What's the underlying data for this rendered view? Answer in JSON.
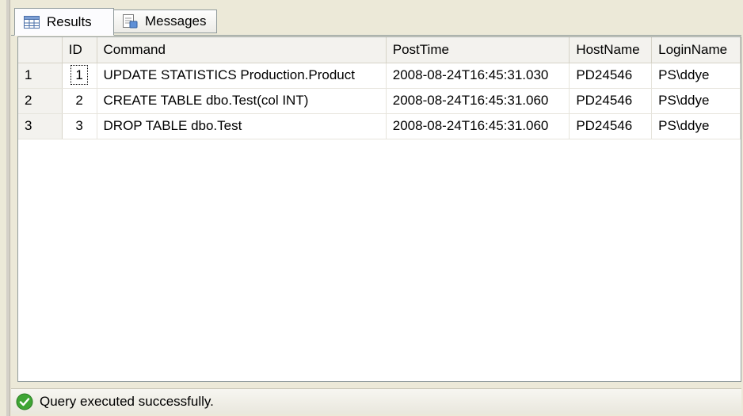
{
  "tabs": {
    "results_label": "Results",
    "messages_label": "Messages",
    "results_icon": "grid-icon",
    "messages_icon": "messages-icon"
  },
  "grid": {
    "columns": [
      "ID",
      "Command",
      "PostTime",
      "HostName",
      "LoginName"
    ],
    "rows": [
      {
        "rownum": "1",
        "id": "1",
        "command": "UPDATE STATISTICS Production.Product",
        "posttime": "2008-08-24T16:45:31.030",
        "hostname": "PD24546",
        "loginname": "PS\\ddye"
      },
      {
        "rownum": "2",
        "id": "2",
        "command": "CREATE TABLE dbo.Test(col INT)",
        "posttime": "2008-08-24T16:45:31.060",
        "hostname": "PD24546",
        "loginname": "PS\\ddye"
      },
      {
        "rownum": "3",
        "id": "3",
        "command": "DROP TABLE dbo.Test",
        "posttime": "2008-08-24T16:45:31.060",
        "hostname": "PD24546",
        "loginname": "PS\\ddye"
      }
    ]
  },
  "status": {
    "text": "Query executed successfully.",
    "icon": "success-check-icon",
    "icon_color": "#3fa535"
  }
}
